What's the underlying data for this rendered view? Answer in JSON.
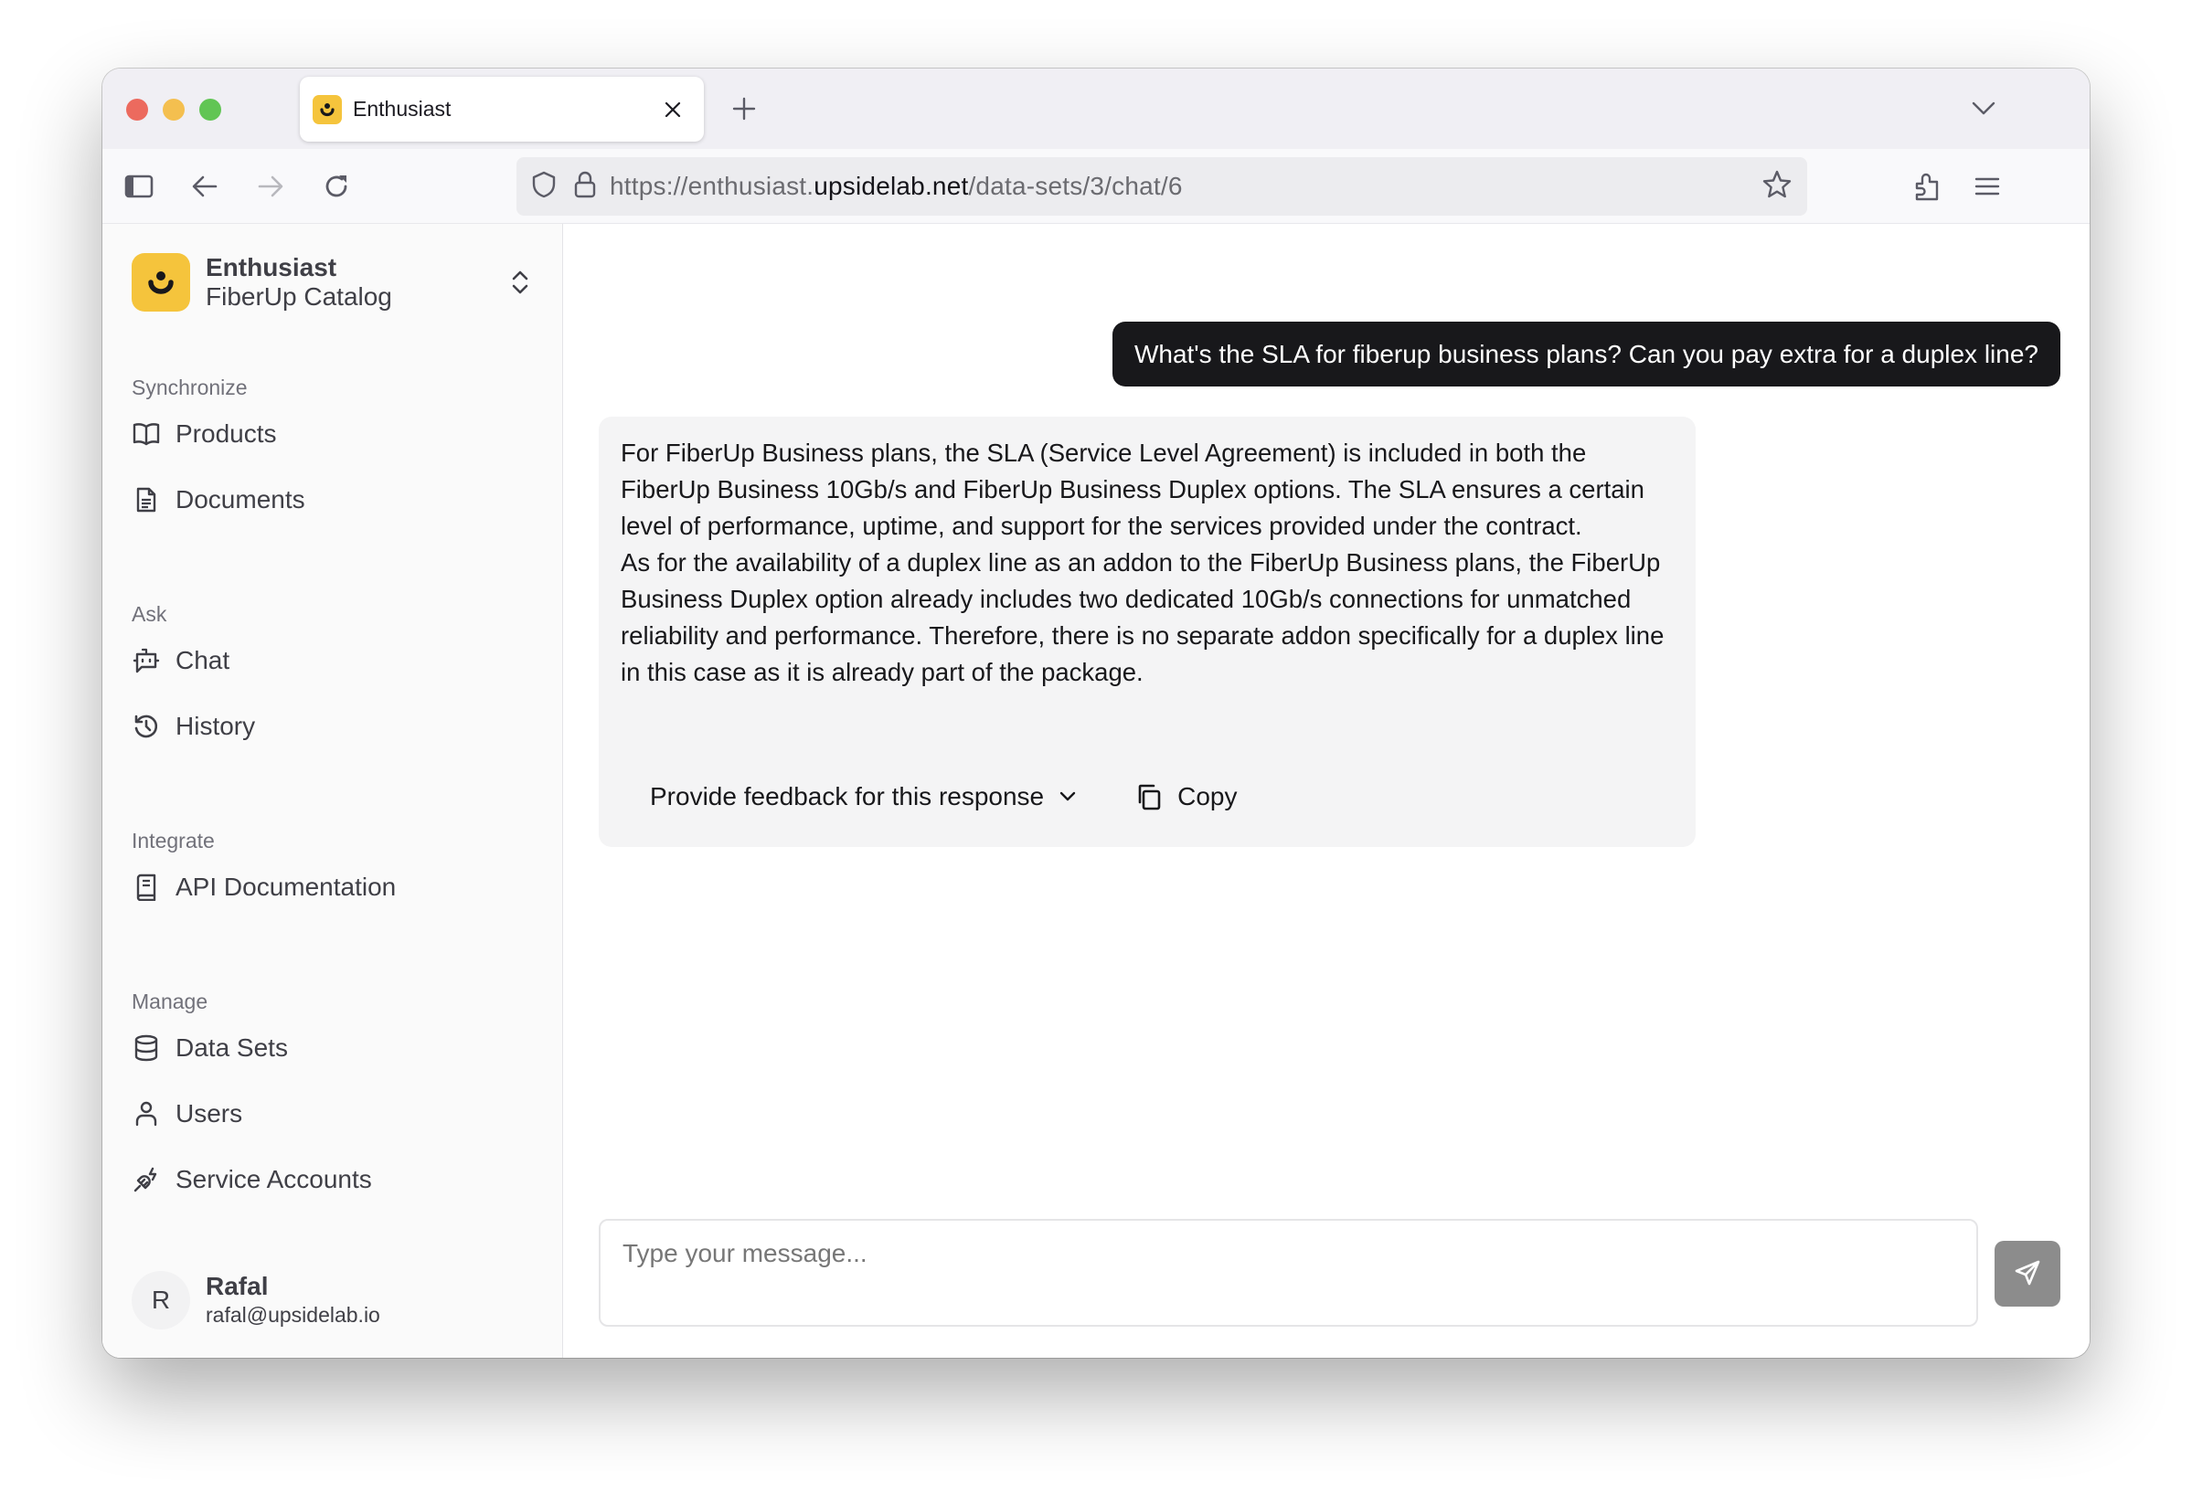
{
  "browser": {
    "tab_title": "Enthusiast",
    "url_scheme": "https://enthusiast.",
    "url_host": "upsidelab.net",
    "url_path": "/data-sets/3/chat/6",
    "icons": {
      "sidebar_toggle": "sidebar-icon",
      "back": "arrow-left-icon",
      "forward": "arrow-right-icon",
      "reload": "reload-icon",
      "tracking": "shield-icon",
      "lock": "lock-icon",
      "bookmark": "star-icon",
      "extensions": "puzzle-icon",
      "menu": "hamburger-icon",
      "new_tab": "plus-icon",
      "tab_list": "chevron-down-icon",
      "close_tab": "close-icon"
    }
  },
  "sidebar": {
    "brand": {
      "name": "Enthusiast",
      "dataset": "FiberUp Catalog"
    },
    "sections": [
      {
        "label": "Synchronize",
        "items": [
          {
            "label": "Products",
            "icon": "book-open-icon"
          },
          {
            "label": "Documents",
            "icon": "document-icon"
          }
        ]
      },
      {
        "label": "Ask",
        "items": [
          {
            "label": "Chat",
            "icon": "bot-icon"
          },
          {
            "label": "History",
            "icon": "history-icon"
          }
        ]
      },
      {
        "label": "Integrate",
        "items": [
          {
            "label": "API Documentation",
            "icon": "book-icon"
          }
        ]
      },
      {
        "label": "Manage",
        "items": [
          {
            "label": "Data Sets",
            "icon": "database-icon"
          },
          {
            "label": "Users",
            "icon": "user-icon"
          },
          {
            "label": "Service Accounts",
            "icon": "plug-icon"
          }
        ]
      }
    ],
    "user": {
      "initial": "R",
      "name": "Rafal",
      "email": "rafal@upsidelab.io"
    }
  },
  "chat": {
    "messages": [
      {
        "role": "user",
        "text": "What's the SLA for fiberup business plans? Can you pay extra for a duplex line?"
      },
      {
        "role": "assistant",
        "paragraphs": [
          "For FiberUp Business plans, the SLA (Service Level Agreement) is included in both the FiberUp Business 10Gb/s and FiberUp Business Duplex options. The SLA ensures a certain level of performance, uptime, and support for the services provided under the contract.",
          "As for the availability of a duplex line as an addon to the FiberUp Business plans, the FiberUp Business Duplex option already includes two dedicated 10Gb/s connections for unmatched reliability and performance. Therefore, there is no separate addon specifically for a duplex line in this case as it is already part of the package."
        ],
        "feedback_label": "Provide feedback for this response",
        "copy_label": "Copy"
      }
    ],
    "input": {
      "value": "",
      "placeholder": "Type your message..."
    },
    "send_icon": "send-icon"
  },
  "colors": {
    "brand_yellow": "#f5c43c",
    "user_bubble": "#18181b",
    "assistant_bubble": "#f4f4f5",
    "send_button": "#8c8c8c"
  }
}
